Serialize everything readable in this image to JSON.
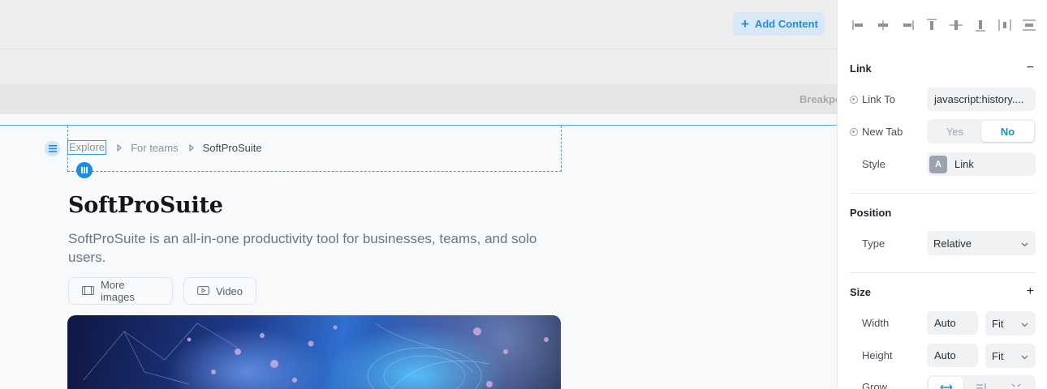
{
  "toolbar": {
    "add_content_label": "Add Content"
  },
  "breakpoint_label": "Breakpoints",
  "breadcrumb": {
    "items": [
      "Explore",
      "For teams",
      "SoftProSuite"
    ]
  },
  "product": {
    "title": "SoftProSuite",
    "description": "SoftProSuite is an all-in-one productivity tool for businesses, teams, and solo users.",
    "more_images_label": "More images",
    "video_label": "Video"
  },
  "panel": {
    "link": {
      "title": "Link",
      "link_to_label": "Link To",
      "link_to_value": "javascript:history....",
      "new_tab_label": "New Tab",
      "new_tab_options": [
        "Yes",
        "No"
      ],
      "new_tab_selected": "No",
      "style_label": "Style",
      "style_badge": "A",
      "style_value": "Link"
    },
    "position": {
      "title": "Position",
      "type_label": "Type",
      "type_value": "Relative"
    },
    "size": {
      "title": "Size",
      "width_label": "Width",
      "width_value": "Auto",
      "width_mode": "Fit",
      "height_label": "Height",
      "height_value": "Auto",
      "height_mode": "Fit",
      "grow_label": "Grow"
    }
  },
  "colors": {
    "accent": "#1a8ee0",
    "selection": "#2f9fdf"
  }
}
